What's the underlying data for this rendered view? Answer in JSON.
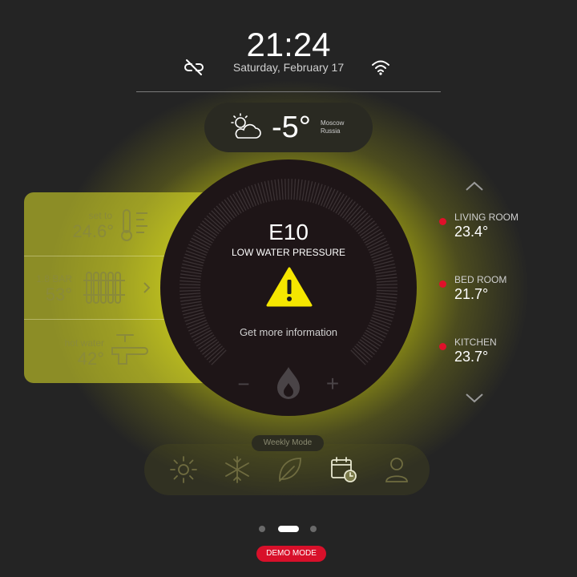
{
  "header": {
    "time": "21:24",
    "date": "Saturday, February 17",
    "icons": [
      "link-broken-icon",
      "wifi-icon"
    ]
  },
  "weather": {
    "icon": "partly-cloudy-icon",
    "temperature": "-5°",
    "city": "Moscow",
    "country": "Russia"
  },
  "left_panel": {
    "heating": {
      "label": "set to",
      "value": "24.6°",
      "icon": "thermometer-icon"
    },
    "radiator": {
      "label": "1.8 BAR",
      "value": "53°",
      "icon": "radiator-icon"
    },
    "water": {
      "label": "hot water",
      "value": "42°",
      "icon": "faucet-icon"
    }
  },
  "dial": {
    "error_code": "E10",
    "error_text": "LOW WATER PRESSURE",
    "link_text": "Get more information",
    "minus": "−",
    "plus": "+",
    "icons": [
      "warning-icon",
      "flame-icon"
    ]
  },
  "rooms": [
    {
      "name": "LIVING ROOM",
      "temp": "23.4°"
    },
    {
      "name": "BED ROOM",
      "temp": "21.7°"
    },
    {
      "name": "KITCHEN",
      "temp": "23.7°"
    }
  ],
  "mode": {
    "label": "Weekly Mode",
    "buttons": [
      "sun-icon",
      "snowflake-icon",
      "leaf-icon",
      "calendar-clock-icon",
      "user-icon"
    ]
  },
  "pager": {
    "pages": 3,
    "active": 2
  },
  "demo_label": "DEMO MODE",
  "colors": {
    "accent_red": "#d8102a",
    "glow_yellow": "#e4e400",
    "dial_bg": "#1e1517"
  }
}
